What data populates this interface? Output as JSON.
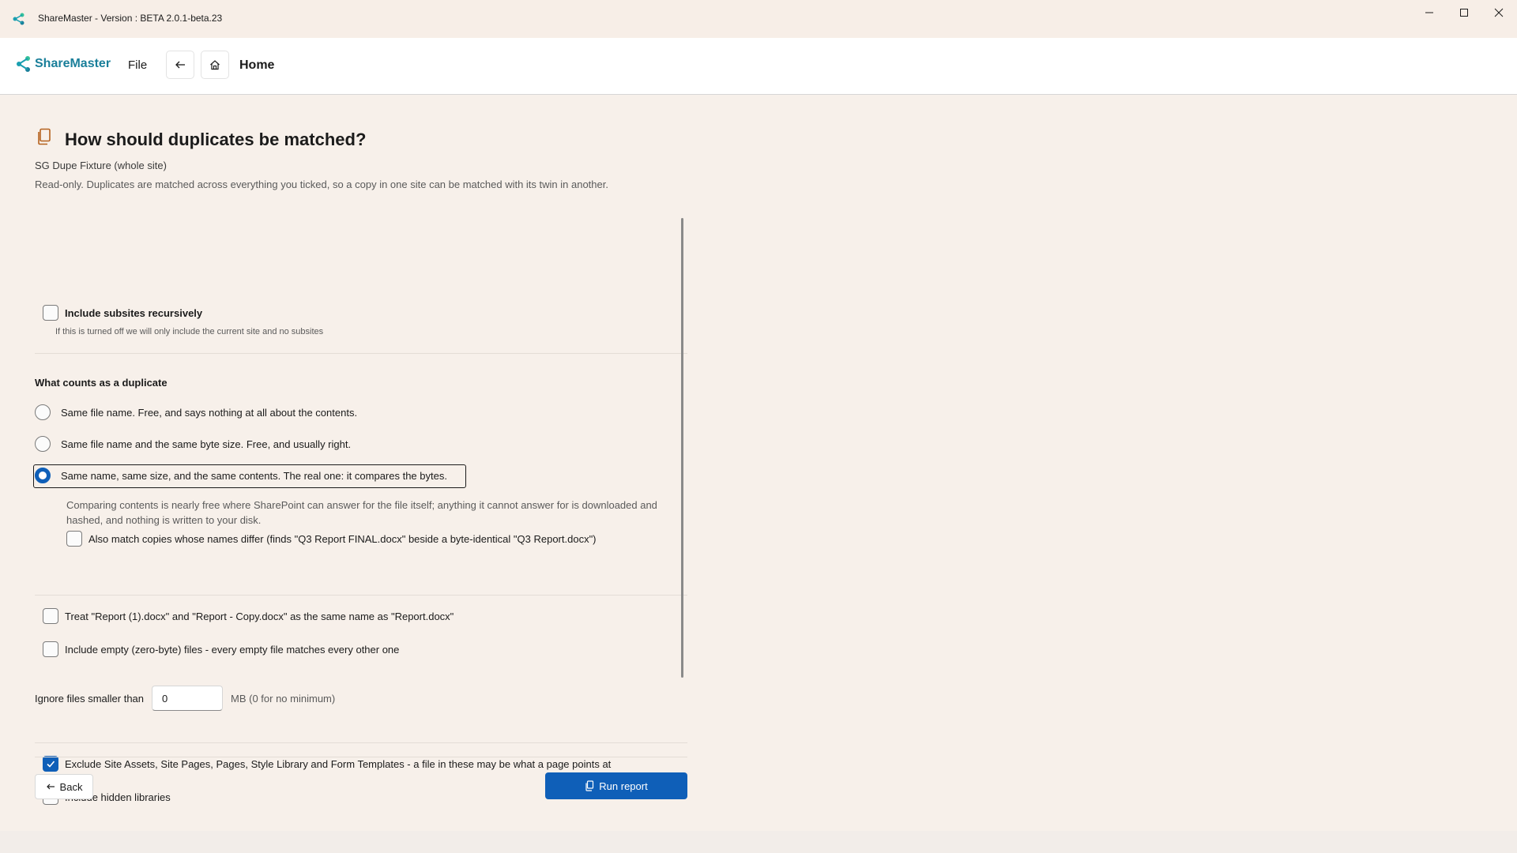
{
  "window": {
    "title": "ShareMaster - Version : BETA 2.0.1-beta.23"
  },
  "nav": {
    "logo_text": "ShareMaster",
    "file_label": "File",
    "home_label": "Home"
  },
  "page": {
    "title": "How should duplicates be matched?",
    "subtitle": "SG Dupe Fixture (whole site)",
    "description": "Read-only. Duplicates are matched across everything you ticked, so a copy in one site can be matched with its twin in another."
  },
  "options": {
    "subsites": {
      "label": "Include subsites recursively",
      "hint": "If this is turned off we will only include the current site and no subsites",
      "checked": false
    },
    "duplicate_section": {
      "heading": "What counts as a duplicate",
      "choices": [
        {
          "label": "Same file name. Free, and says nothing at all about the contents.",
          "selected": false
        },
        {
          "label": "Same file name and the same byte size. Free, and usually right.",
          "selected": false
        },
        {
          "label": "Same name, same size, and the same contents. The real one: it compares the bytes.",
          "selected": true
        }
      ],
      "contents_note": "Comparing contents is nearly free where SharePoint can answer for the file itself; anything it cannot answer for is downloaded and hashed, and nothing is written to your disk.",
      "names_differ_label": "Also match copies whose names differ (finds \"Q3 Report FINAL.docx\" beside a byte-identical \"Q3 Report.docx\")"
    },
    "treat_copies_label": "Treat \"Report (1).docx\" and \"Report - Copy.docx\" as the same name as \"Report.docx\"",
    "empty_files_label": "Include empty (zero-byte) files - every empty file matches every other one",
    "min_size": {
      "label": "Ignore files smaller than",
      "value": "0",
      "unit": "MB (0 for no minimum)"
    },
    "exclude_libs_label": "Exclude Site Assets, Site Pages, Pages, Style Library and Form Templates - a file in these may be what a page points at",
    "hidden_libs_label": "Include hidden libraries"
  },
  "actions": {
    "back_label": "Back",
    "run_label": "Run report"
  },
  "colors": {
    "accent": "#0f5fb8",
    "background": "#f7f0ea"
  }
}
